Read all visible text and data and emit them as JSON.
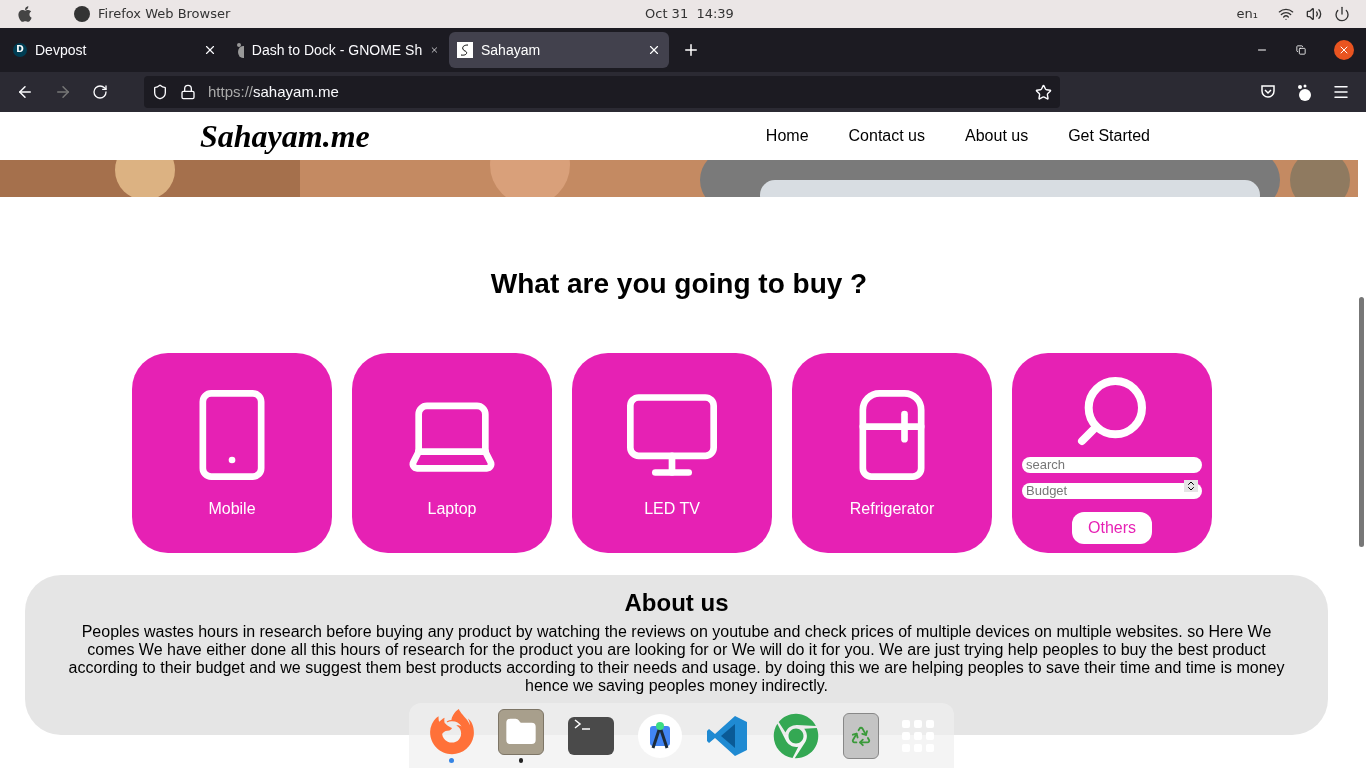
{
  "top_bar": {
    "app_name": "Firefox Web Browser",
    "clock": "Oct 31  14:39",
    "keyboard_layout": "en₁"
  },
  "tabs": [
    {
      "title": "Devpost",
      "favicon": "D",
      "selected": false
    },
    {
      "title": "Dash to Dock - GNOME Sh",
      "selected": false
    },
    {
      "title": "Sahayam",
      "selected": true
    }
  ],
  "address_bar": {
    "scheme": "https://",
    "host": "sahayam.me"
  },
  "site": {
    "logo": "Sahayam.me",
    "nav": [
      "Home",
      "Contact us",
      "About us",
      "Get Started"
    ]
  },
  "heading": "What are you going to buy ?",
  "categories": [
    {
      "kind": "phone",
      "label": "Mobile"
    },
    {
      "kind": "laptop",
      "label": "Laptop"
    },
    {
      "kind": "tv",
      "label": "LED TV"
    },
    {
      "kind": "fridge",
      "label": "Refrigerator"
    },
    {
      "kind": "search",
      "search_placeholder": "search",
      "budget_placeholder": "Budget",
      "button": "Others"
    }
  ],
  "about": {
    "title": "About us",
    "text": "Peoples wastes hours in research before buying any product by watching the reviews on youtube and check prices of multiple devices on multiple websites. so Here We comes We have either done all this hours of research for the product you are looking for or We will do it for you. We are just trying help peoples to buy the best product according to their budget and we suggest them best products according to their needs and usage. by doing this we are helping peoples to save their time and time is money hence we saving peoples money indirectly."
  },
  "dock": [
    {
      "kind": "browser",
      "running": true,
      "focused": true
    },
    {
      "kind": "files",
      "running": true,
      "focused": false
    },
    {
      "kind": "terminal",
      "running": false,
      "focused": false
    },
    {
      "kind": "studio",
      "running": false,
      "focused": false
    },
    {
      "kind": "editor",
      "running": false,
      "focused": false
    },
    {
      "kind": "chrome",
      "running": false,
      "focused": false
    },
    {
      "kind": "trash",
      "running": false,
      "focused": false
    },
    {
      "kind": "grid",
      "running": false,
      "focused": false
    }
  ]
}
